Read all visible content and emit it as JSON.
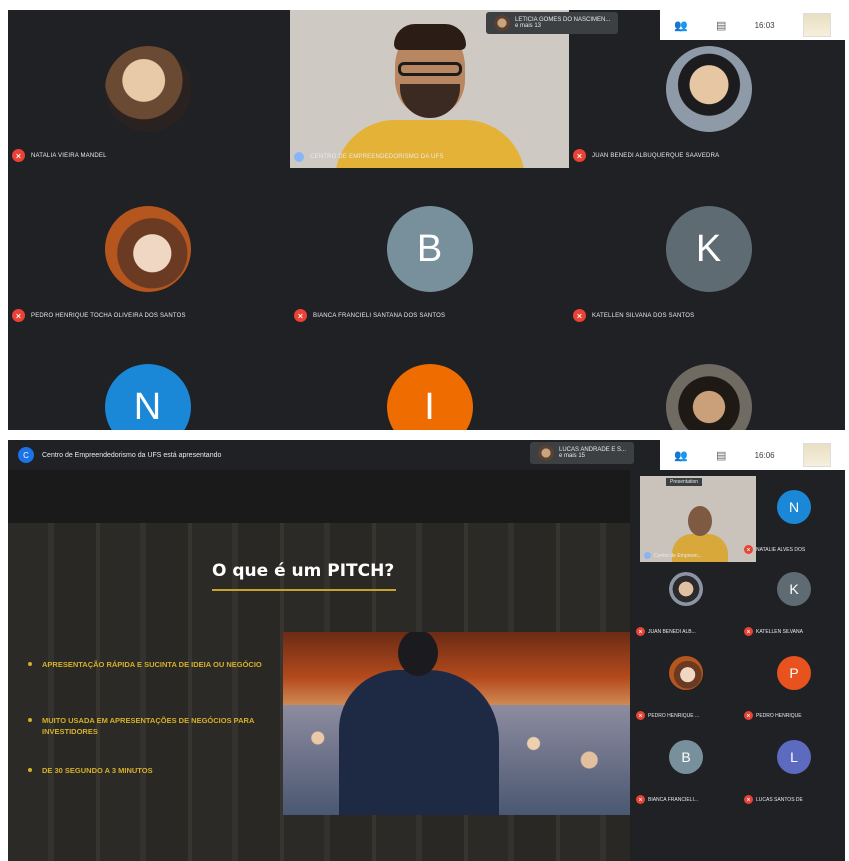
{
  "top": {
    "toolbar": {
      "time": "16:03"
    },
    "participants_chip": {
      "name": "LETICIA GOMES DO NASCIMEN...",
      "more": "e mais 13"
    },
    "tiles": [
      {
        "name": "NATALIA VIEIRA MANDEL",
        "type": "photo",
        "mic": "off"
      },
      {
        "name": "Centro de Empreendedorismo da UFS",
        "type": "video",
        "mic": "on"
      },
      {
        "name": "JUAN BENEDI ALBUQUERQUE SAAVEDRA",
        "type": "photo",
        "mic": "off"
      },
      {
        "name": "PEDRO HENRIQUE TOCHA OLIVEIRA DOS SANTOS",
        "type": "photo",
        "mic": "off"
      },
      {
        "name": "BIANCA FRANCIELI SANTANA DOS SANTOS",
        "type": "letter",
        "letter": "B",
        "color": "#78909c",
        "mic": "off"
      },
      {
        "name": "KATELLEN SILVANA DOS SANTOS",
        "type": "letter",
        "letter": "K",
        "color": "#5f6b73",
        "mic": "off"
      },
      {
        "type": "letter",
        "letter": "N",
        "color": "#1a88d6"
      },
      {
        "type": "letter",
        "letter": "I",
        "color": "#ef6c00"
      },
      {
        "type": "photo"
      }
    ]
  },
  "bottom": {
    "presenting_text": "Centro de Empreendedorismo da UFS está apresentando",
    "presenting_icon": "C",
    "toolbar": {
      "time": "16:06"
    },
    "participants_chip": {
      "name": "LUCAS ANDRADE E S...",
      "more": "e mais 15"
    },
    "slide": {
      "title": "O que é um PITCH?",
      "bullets": [
        "APRESENTAÇÃO RÁPIDA E SUCINTA DE IDEIA OU NEGÓCIO",
        "MUITO USADA EM APRESENTAÇÕES DE NEGÓCIOS PARA INVESTIDORES",
        "DE 30 SEGUNDO A 3 MINUTOS"
      ]
    },
    "side_tiles": [
      {
        "name": "Centro de Empreen...",
        "type": "presenter",
        "tag": "Presentation"
      },
      {
        "name": "NATALIE ALVES DOS",
        "letter": "N",
        "color": "#1a88d6"
      },
      {
        "name": "JUAN BENEDI ALB...",
        "type": "photo"
      },
      {
        "name": "KATELLEN SILVANA",
        "letter": "K",
        "color": "#5f6b73"
      },
      {
        "name": "PEDRO HENRIQUE ...",
        "type": "photo"
      },
      {
        "name": "PEDRO HENRIQUE",
        "letter": "P",
        "color": "#e8521f"
      },
      {
        "name": "BIANCA FRANCIELI...",
        "letter": "B",
        "color": "#78909c"
      },
      {
        "name": "LUCAS SANTOS DE",
        "letter": "L",
        "color": "#5c6bc0"
      }
    ]
  },
  "colors": {
    "meet_dark": "#202124",
    "mic_off": "#ea4335",
    "slide_accent": "#d4b02a"
  }
}
